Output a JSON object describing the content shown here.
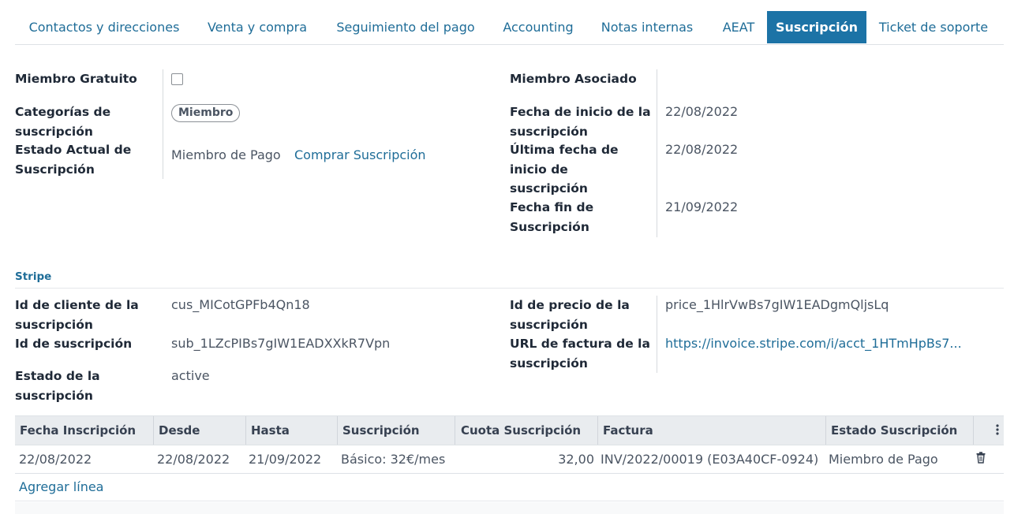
{
  "tabs": [
    {
      "label": "Contactos y direcciones"
    },
    {
      "label": "Venta y compra"
    },
    {
      "label": "Seguimiento del pago"
    },
    {
      "label": "Accounting"
    },
    {
      "label": "Notas internas"
    },
    {
      "label": "AEAT"
    },
    {
      "label": "Suscripción",
      "active": true
    },
    {
      "label": "Ticket de soporte"
    }
  ],
  "membership": {
    "free_member_label": "Miembro Gratuito",
    "free_member_checked": false,
    "categories_label_1": "Categorías de",
    "categories_label_2": "suscripción",
    "category_tag": "Miembro",
    "current_state_label_1": "Estado Actual de",
    "current_state_label_2": "Suscripción",
    "current_state_value": "Miembro de Pago",
    "buy_link": "Comprar Suscripción",
    "associated_label": "Miembro Asociado",
    "start_label_1": "Fecha de inicio de la",
    "start_label_2": "suscripción",
    "start_value": "22/08/2022",
    "last_start_label_1": "Última fecha de",
    "last_start_label_2": "inicio de",
    "last_start_label_3": "suscripción",
    "last_start_value": "22/08/2022",
    "end_label_1": "Fecha fin de",
    "end_label_2": "Suscripción",
    "end_value": "21/09/2022"
  },
  "stripe": {
    "title": "Stripe",
    "client_id_label_1": "Id de cliente de la",
    "client_id_label_2": "suscripción",
    "client_id_value": "cus_MICotGPFb4Qn18",
    "sub_id_label": "Id de suscripción",
    "sub_id_value": "sub_1LZcPIBs7gIW1EADXXkR7Vpn",
    "state_label_1": "Estado de la",
    "state_label_2": "suscripción",
    "state_value": "active",
    "price_id_label_1": "Id de precio de la",
    "price_id_label_2": "suscripción",
    "price_id_value": "price_1HlrVwBs7gIW1EADgmQljsLq",
    "invoice_url_label_1": "URL de factura de la",
    "invoice_url_label_2": "suscripción",
    "invoice_url_value": "https://invoice.stripe.com/i/acct_1HTmHpBs7..."
  },
  "table": {
    "headers": [
      "Fecha Inscripción",
      "Desde",
      "Hasta",
      "Suscripción",
      "Cuota Suscripción",
      "Factura",
      "Estado Suscripción"
    ],
    "rows": [
      [
        "22/08/2022",
        "22/08/2022",
        "21/09/2022",
        "Básico: 32€/mes",
        "32,00",
        "INV/2022/00019 (E03A40CF-0924)",
        "Miembro de Pago"
      ]
    ],
    "add_line": "Agregar línea"
  },
  "icons": {
    "kebab": "vertical-ellipsis-icon",
    "delete": "trash-icon"
  },
  "colors": {
    "accent": "#1c73a6",
    "link": "#1f6d98",
    "table_header_bg": "#e9ecef"
  }
}
